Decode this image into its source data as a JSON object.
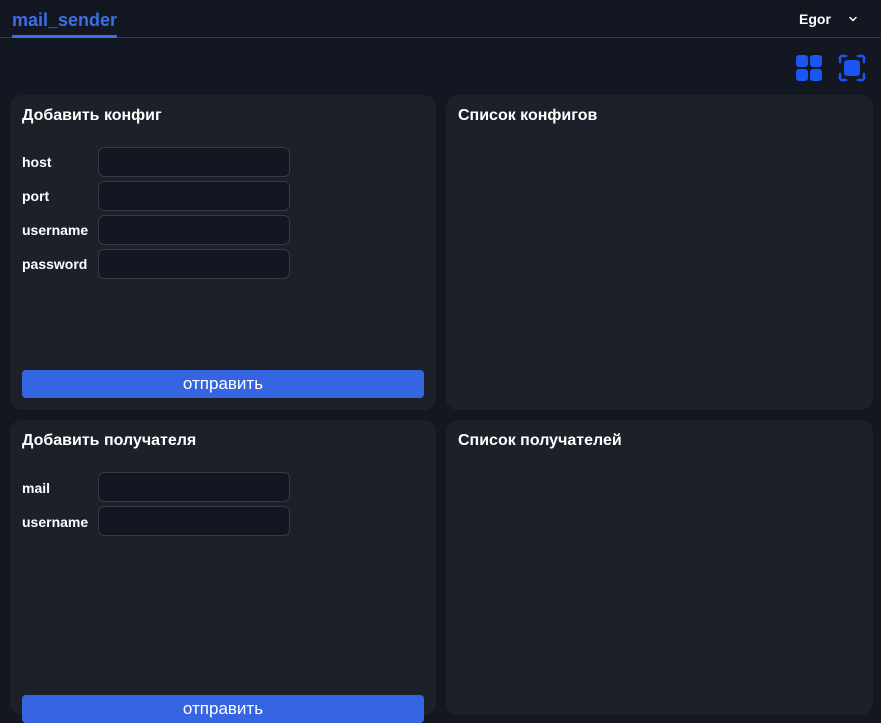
{
  "header": {
    "app_title": "mail_sender",
    "user_name": "Egor"
  },
  "toolbar": {
    "grid_icon": "grid-view-icon",
    "focus_icon": "fullscreen-icon",
    "accent_color": "#1a56f0"
  },
  "add_config": {
    "title": "Добавить конфиг",
    "fields": [
      {
        "label": "host",
        "value": ""
      },
      {
        "label": "port",
        "value": ""
      },
      {
        "label": "username",
        "value": ""
      },
      {
        "label": "password",
        "value": ""
      }
    ],
    "submit_label": "отправить"
  },
  "config_list": {
    "title": "Список конфигов"
  },
  "add_recipient": {
    "title": "Добавить получателя",
    "fields": [
      {
        "label": "mail",
        "value": ""
      },
      {
        "label": "username",
        "value": ""
      }
    ],
    "submit_label": "отправить"
  },
  "recipient_list": {
    "title": "Список получателей"
  }
}
